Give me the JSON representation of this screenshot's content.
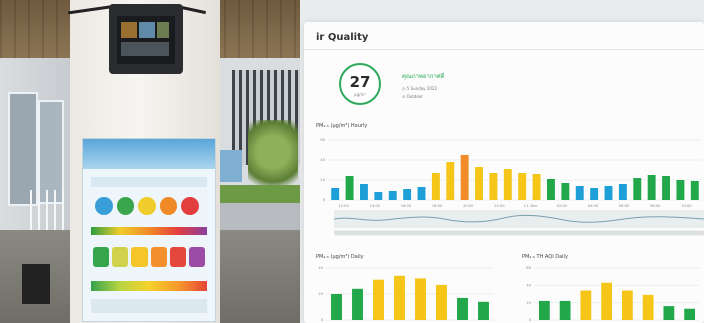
{
  "panel": {
    "title": "ir Quality",
    "aqi_value": "27",
    "aqi_unit": "µg/m³",
    "status_text": "คุณภาพอากาศดี",
    "meta1": "◷ 5 Sunday 2022",
    "meta2": "⊙ Outdoor"
  },
  "colors": {
    "good": "#22a84a",
    "moderate": "#f5c518",
    "unhealthy_sensitive": "#f28c28",
    "excellent": "#1e9fd8"
  },
  "hourly": {
    "label": "PM₂.₅ (µg/m³) Hourly",
    "x_ticks": [
      "12:00",
      "14:00",
      "16:00",
      "18:00",
      "20:00",
      "22:00",
      "11. Dec",
      "02:00",
      "04:00",
      "06:00",
      "08:00",
      "10:00"
    ],
    "y_ticks": [
      "60",
      "40",
      "20",
      "0"
    ]
  },
  "daily": {
    "label": "PM₂.₅ (µg/m³) Daily",
    "y_ticks": [
      "40",
      "20",
      "0"
    ]
  },
  "daily_aqi": {
    "label": "PM₂.₅ TH AQI Daily",
    "y_ticks": [
      "60",
      "40",
      "20",
      "0"
    ]
  },
  "chart_data": [
    {
      "type": "bar",
      "title": "PM₂.₅ (µg/m³) Hourly",
      "x": [
        "12:00",
        "13:00",
        "14:00",
        "15:00",
        "16:00",
        "17:00",
        "18:00",
        "19:00",
        "20:00",
        "21:00",
        "22:00",
        "23:00",
        "11. Dec",
        "01:00",
        "02:00",
        "03:00",
        "04:00",
        "05:00",
        "06:00",
        "07:00",
        "08:00",
        "09:00",
        "10:00",
        "11:00",
        "12:00",
        "13:00"
      ],
      "values": [
        12,
        24,
        16,
        8,
        9,
        11,
        13,
        27,
        38,
        45,
        33,
        27,
        31,
        27,
        26,
        21,
        17,
        14,
        12,
        14,
        16,
        22,
        25,
        24,
        20,
        19
      ],
      "colors": [
        "excellent",
        "good",
        "excellent",
        "excellent",
        "excellent",
        "excellent",
        "excellent",
        "moderate",
        "moderate",
        "unhealthy_sensitive",
        "moderate",
        "moderate",
        "moderate",
        "moderate",
        "moderate",
        "good",
        "good",
        "excellent",
        "excellent",
        "excellent",
        "excellent",
        "good",
        "good",
        "good",
        "good",
        "good"
      ],
      "ylim": [
        0,
        60
      ],
      "grid": true
    },
    {
      "type": "bar",
      "title": "PM₂.₅ (µg/m³) Daily",
      "values": [
        20,
        24,
        31,
        34,
        32,
        27,
        17,
        14
      ],
      "colors": [
        "good",
        "good",
        "moderate",
        "moderate",
        "moderate",
        "moderate",
        "good",
        "good"
      ],
      "ylim": [
        0,
        40
      ],
      "grid": true
    },
    {
      "type": "bar",
      "title": "PM₂.₅ TH AQI Daily",
      "values": [
        22,
        22,
        34,
        43,
        34,
        29,
        16,
        13
      ],
      "colors": [
        "good",
        "good",
        "moderate",
        "moderate",
        "moderate",
        "moderate",
        "good",
        "good"
      ],
      "ylim": [
        0,
        60
      ],
      "grid": true
    }
  ]
}
